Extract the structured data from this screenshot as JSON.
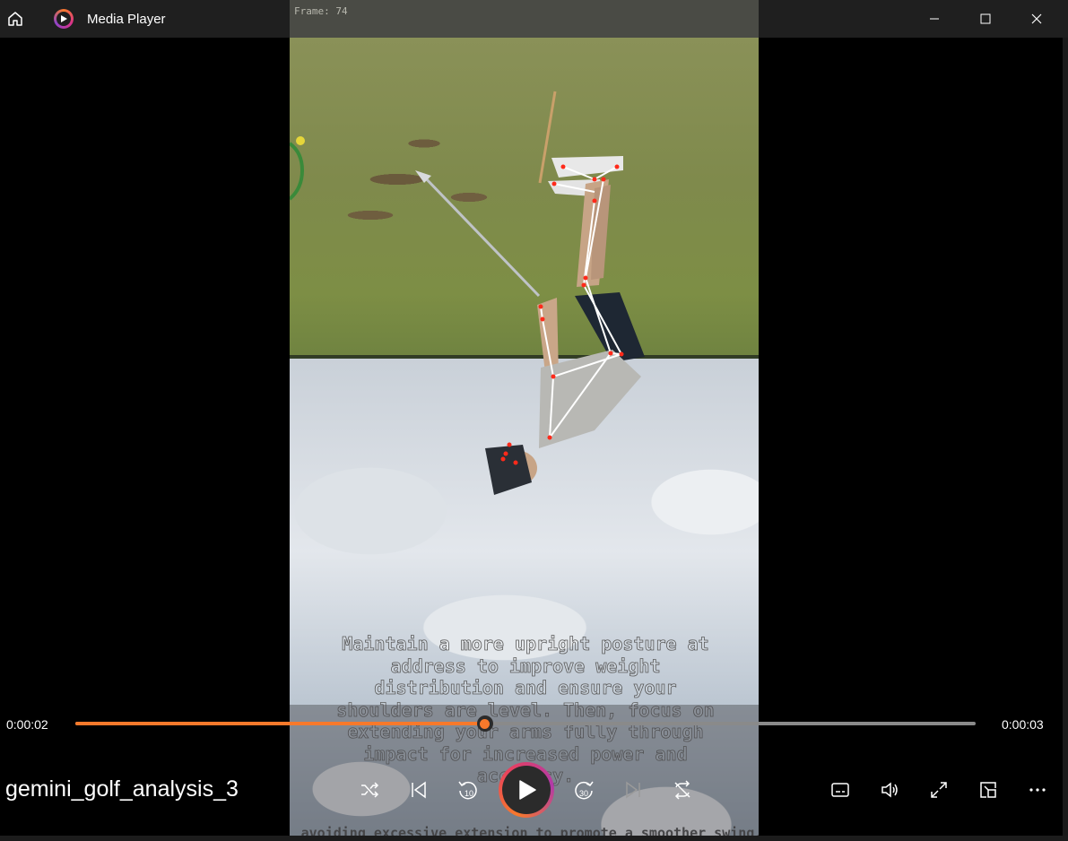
{
  "app": {
    "title": "Media Player",
    "icons": {
      "home": "home-icon",
      "app": "media-player-logo-icon",
      "minimize": "minimize-icon",
      "maximize": "maximize-icon",
      "close": "close-icon"
    }
  },
  "video": {
    "frame_label": "Frame: 74",
    "caption": "Maintain a more upright posture at address to improve weight distribution and ensure your shoulders are level. Then, focus on extending your arms fully through impact for increased power and accuracy.",
    "caption_lines": [
      "Maintain a more upright posture at",
      "address to improve weight",
      "distribution and ensure your",
      "shoulders are level. Then, focus on",
      "extending your arms fully through",
      "impact for increased power and",
      "accuracy."
    ],
    "caption_partial": "avoiding excessive extension to promote a smoother swing."
  },
  "player": {
    "file_name": "gemini_golf_analysis_3",
    "elapsed": "0:00:02",
    "total": "0:00:03",
    "progress": 0.455,
    "accent_color": "#f7792b",
    "controls": {
      "shuffle": "shuffle-icon",
      "previous": "previous-icon",
      "rewind": "rewind-10-icon",
      "rewind_label": "10",
      "play": "play-icon",
      "forward": "forward-30-icon",
      "forward_label": "30",
      "next": "next-icon",
      "repeat": "repeat-icon",
      "subtitles": "subtitles-icon",
      "volume": "volume-icon",
      "fullscreen": "fullscreen-icon",
      "miniplayer": "miniplayer-icon",
      "more": "more-options-icon"
    }
  }
}
